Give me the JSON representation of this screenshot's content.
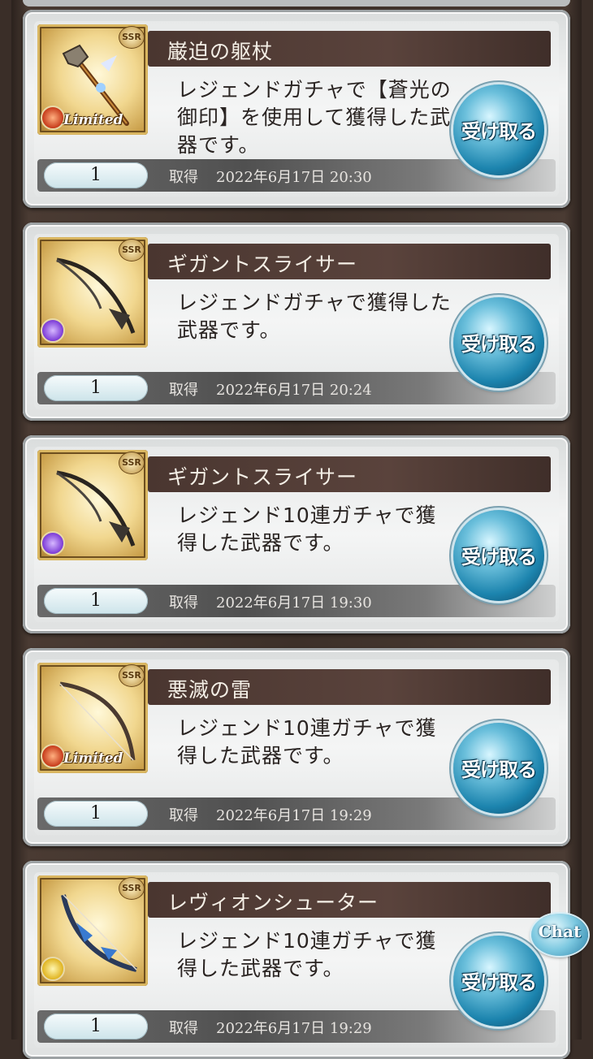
{
  "items": [
    {
      "title": "巌迫の躯杖",
      "description": "レジェンドガチャで【蒼光の御印】を使用して獲得した武器です。",
      "quantity": "1",
      "acquired_label": "取得",
      "acquired_date": "2022年6月17日 20:30",
      "receive_label": "受け取る",
      "rarity": "SSR",
      "element": "fire",
      "limited_label": "Limited",
      "weapon_icon": "staff-icon"
    },
    {
      "title": "ギガントスライサー",
      "description": "レジェンドガチャで獲得した武器です。",
      "quantity": "1",
      "acquired_label": "取得",
      "acquired_date": "2022年6月17日 20:24",
      "receive_label": "受け取る",
      "rarity": "SSR",
      "element": "dark",
      "limited_label": "",
      "weapon_icon": "scythe-icon"
    },
    {
      "title": "ギガントスライサー",
      "description": "レジェンド10連ガチャで獲得した武器です。",
      "quantity": "1",
      "acquired_label": "取得",
      "acquired_date": "2022年6月17日 19:30",
      "receive_label": "受け取る",
      "rarity": "SSR",
      "element": "dark",
      "limited_label": "",
      "weapon_icon": "scythe-icon"
    },
    {
      "title": "悪滅の雷",
      "description": "レジェンド10連ガチャで獲得した武器です。",
      "quantity": "1",
      "acquired_label": "取得",
      "acquired_date": "2022年6月17日 19:29",
      "receive_label": "受け取る",
      "rarity": "SSR",
      "element": "fire",
      "limited_label": "Limited",
      "weapon_icon": "bow-icon"
    },
    {
      "title": "レヴィオンシューター",
      "description": "レジェンド10連ガチャで獲得した武器です。",
      "quantity": "1",
      "acquired_label": "取得",
      "acquired_date": "2022年6月17日 19:29",
      "receive_label": "受け取る",
      "rarity": "SSR",
      "element": "light",
      "limited_label": "",
      "weapon_icon": "bow-icon"
    }
  ],
  "chat": {
    "label": "Chat"
  }
}
